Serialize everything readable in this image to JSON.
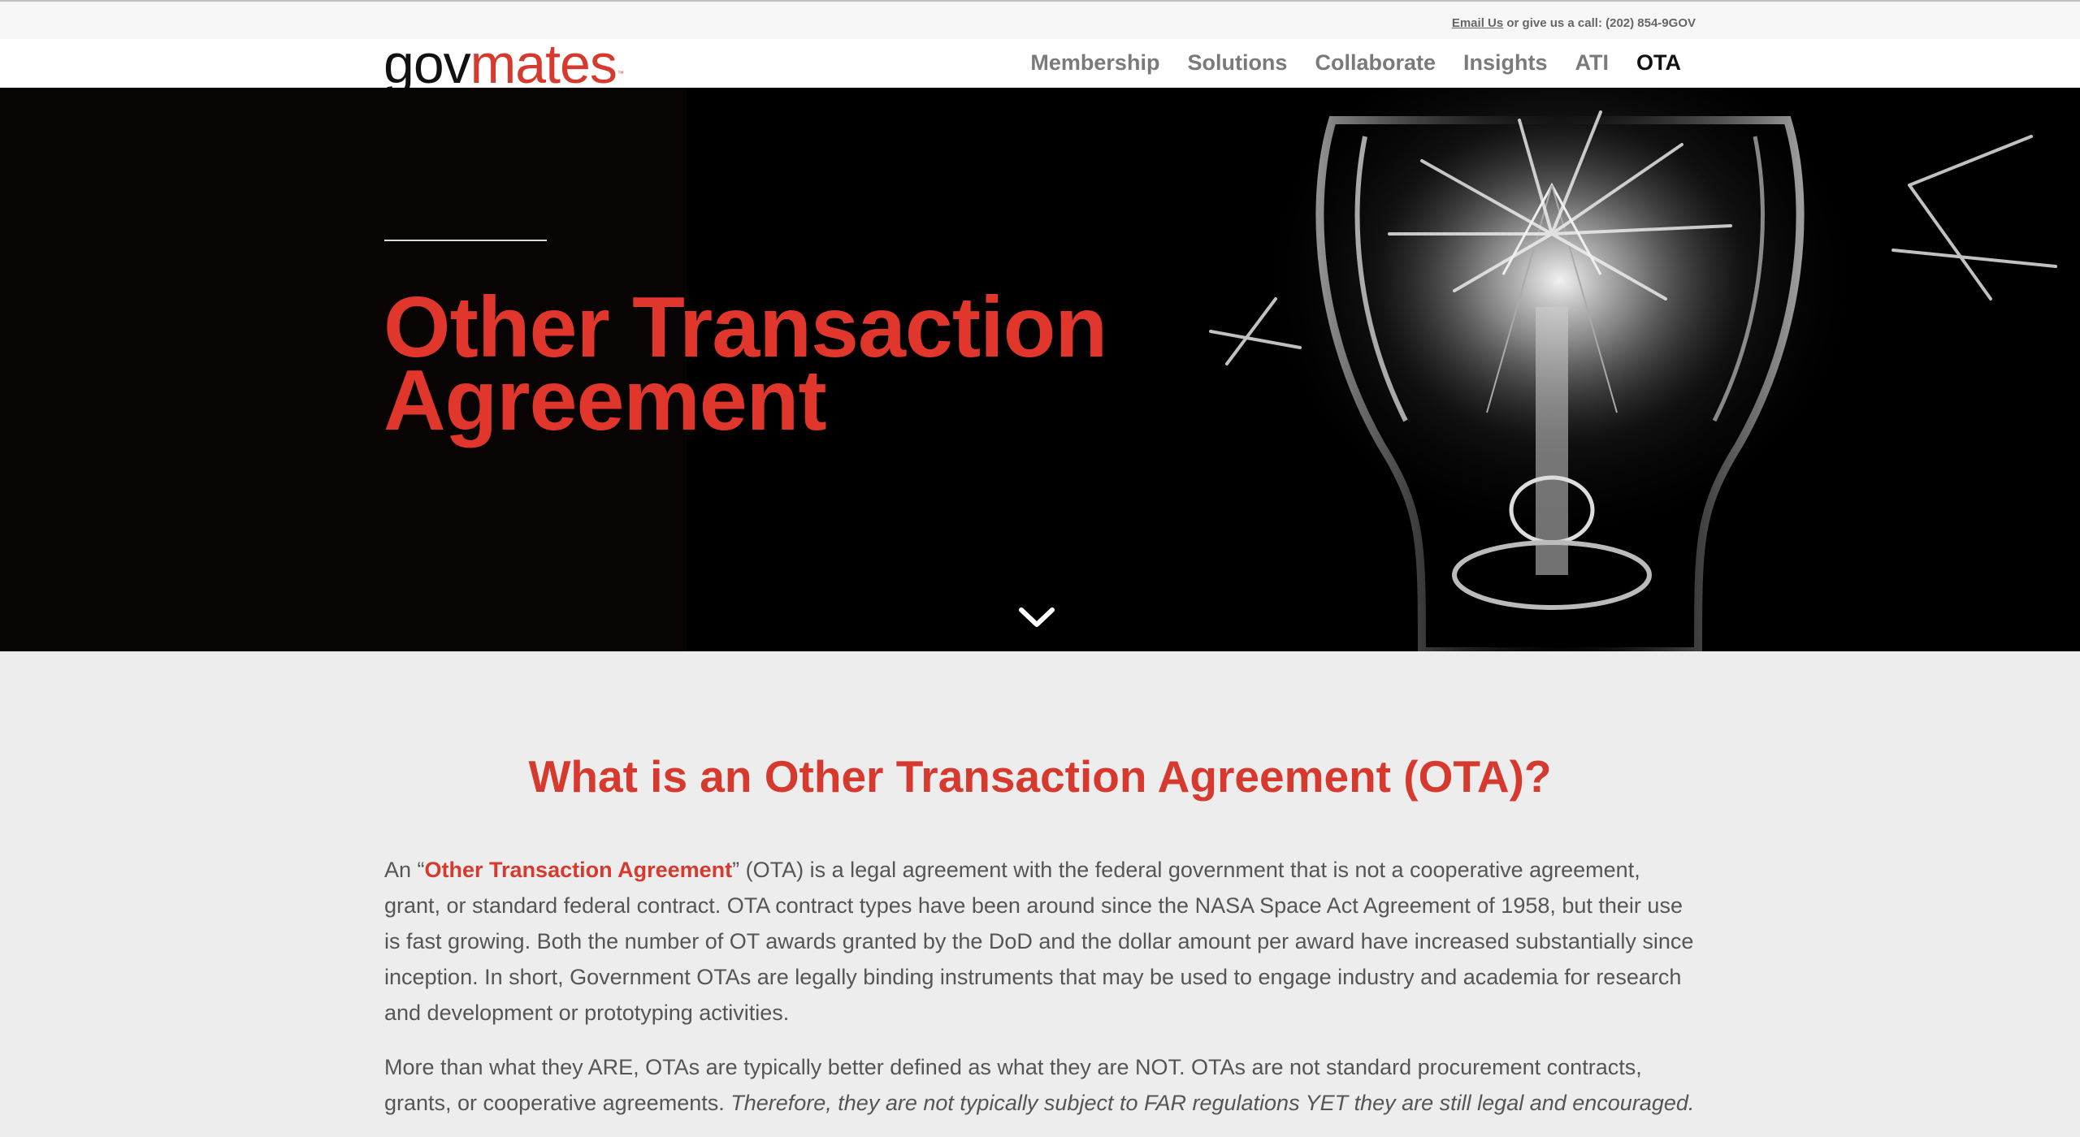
{
  "topbar": {
    "email_link": "Email Us",
    "call_text": " or give us a call: (202) 854-9GOV"
  },
  "header": {
    "logo_gov": "gov",
    "logo_mates": "mates",
    "logo_tm": "™",
    "nav": [
      {
        "label": "Membership"
      },
      {
        "label": "Solutions"
      },
      {
        "label": "Collaborate"
      },
      {
        "label": "Insights"
      },
      {
        "label": "ATI"
      },
      {
        "label": "OTA"
      }
    ]
  },
  "hero": {
    "title_line1": "Other Transaction",
    "title_line2": "Agreement",
    "scroll_icon": "chevron-down-icon"
  },
  "main": {
    "section_title": "What is an Other Transaction Agreement (OTA)?",
    "para1": {
      "prefix": "An “",
      "link": "Other Transaction Agreement",
      "suffix": "” (OTA) is a legal agreement with the federal government that is not a cooperative agreement, grant, or standard federal contract. OTA contract types have been around since the NASA Space Act Agreement of 1958, but their use is fast growing. Both the number of OT awards granted by the DoD and the dollar amount per award have increased substantially since inception. In short, Government OTAs are legally binding instruments that may be used to engage industry and academia for research and development or prototyping activities."
    },
    "para2": {
      "text": "More than what they ARE, OTAs are typically better defined as what they are NOT. OTAs are not standard procurement contracts, grants, or cooperative agreements. ",
      "italic": "Therefore, they are not typically subject to FAR regulations YET they are still legal and encouraged."
    }
  },
  "colors": {
    "brand_red": "#d63a2f",
    "hero_bg": "#000000",
    "content_bg": "#ededed"
  }
}
